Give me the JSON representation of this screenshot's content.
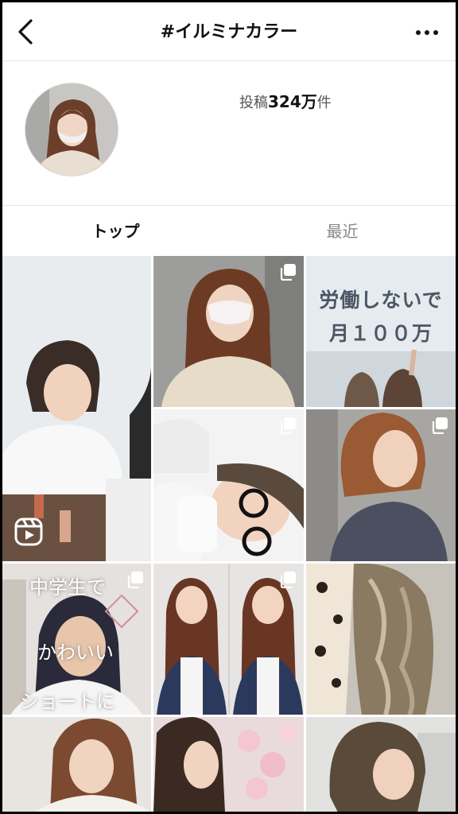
{
  "header": {
    "title": "#イルミナカラー",
    "back_icon": "chevron-left-icon",
    "more_icon": "more-horizontal-icon"
  },
  "profile": {
    "posts_prefix": "投稿",
    "posts_count": "324万",
    "posts_suffix": "件"
  },
  "tabs": [
    {
      "label": "トップ",
      "active": true
    },
    {
      "label": "最近",
      "active": false
    }
  ],
  "grid": {
    "posts": [
      {
        "type": "reel",
        "overlay": ""
      },
      {
        "type": "carousel",
        "overlay": ""
      },
      {
        "type": "image",
        "overlay_line1": "労働しないで",
        "overlay_line2": "月１００万"
      },
      {
        "type": "carousel",
        "overlay": ""
      },
      {
        "type": "carousel",
        "overlay": ""
      },
      {
        "type": "carousel",
        "overlay_line1": "中学生で",
        "overlay_line2": "かわいい",
        "overlay_line3": "ショートに"
      },
      {
        "type": "carousel",
        "overlay": ""
      },
      {
        "type": "image",
        "overlay": ""
      },
      {
        "type": "image",
        "overlay": ""
      },
      {
        "type": "image",
        "overlay": ""
      },
      {
        "type": "image",
        "overlay": ""
      }
    ]
  }
}
